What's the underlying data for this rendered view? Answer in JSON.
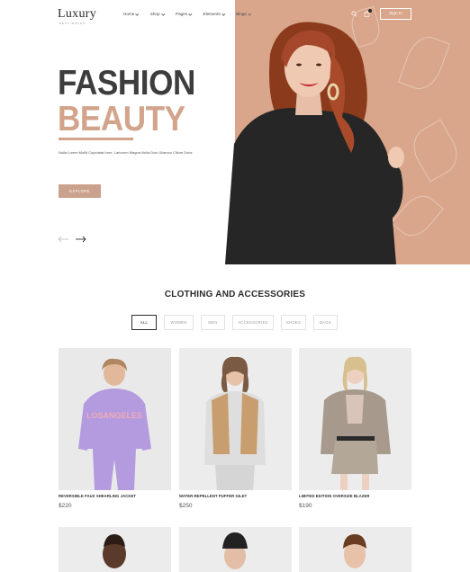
{
  "header": {
    "logo": "Luxury",
    "logo_tagline": "BEST BRAND",
    "nav": [
      {
        "label": "Home"
      },
      {
        "label": "Shop"
      },
      {
        "label": "Pages"
      },
      {
        "label": "Elements"
      },
      {
        "label": "Blogs"
      }
    ],
    "search_icon": "search-icon",
    "cart_icon": "bag-icon",
    "sign_in": "Sign In"
  },
  "hero": {
    "title_line1": "FASHION",
    "title_line2": "BEAUTY",
    "description": "Nulla Lorem Mollit Cupidatat Irure. Laborum Magna Nulla Duis Ullamco Cillum Dolor.",
    "cta": "EXPLORE",
    "accent_color": "#d3a48c",
    "prev_icon": "arrow-left-icon",
    "next_icon": "arrow-right-icon"
  },
  "section": {
    "title": "CLOTHING AND ACCESSORIES",
    "filters": [
      "ALL",
      "WOMEN",
      "MEN",
      "ACCESSORIES",
      "SHOES",
      "BAGS"
    ],
    "active_filter": "ALL"
  },
  "products": [
    {
      "name": "REVERSIBLE FAUX SHEARLING JACKET",
      "price": "$220"
    },
    {
      "name": "WATER-REPELLENT PUFFER GILET",
      "price": "$250"
    },
    {
      "name": "LIMITED EDITION OVERSIZE BLAZER",
      "price": "$190"
    }
  ]
}
